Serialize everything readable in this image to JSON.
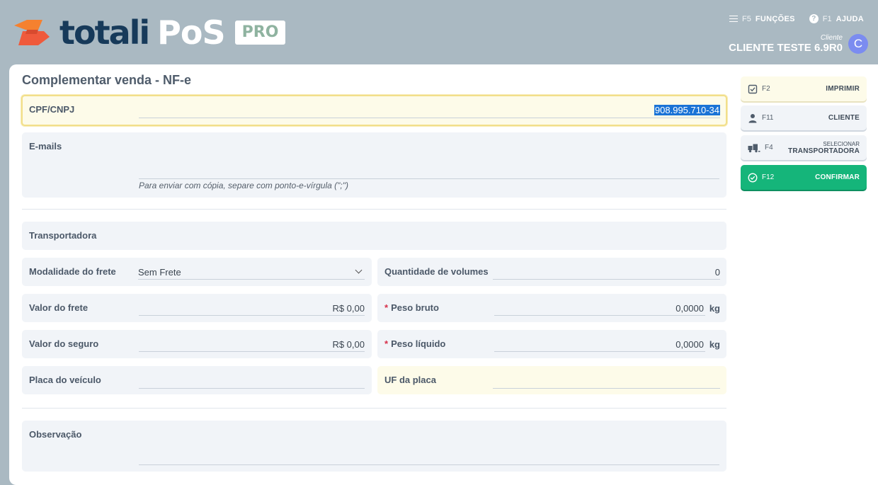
{
  "header": {
    "brand_part1": "totali",
    "brand_part2": "PoS",
    "brand_badge": "PRO",
    "functions_key": "F5",
    "functions_label": "FUNÇÕES",
    "help_key": "F1",
    "help_label": "AJUDA",
    "client_caption": "Cliente",
    "client_name": "CLIENTE TESTE 6.9R0",
    "avatar_letter": "C"
  },
  "page": {
    "title": "Complementar venda - NF-e"
  },
  "form": {
    "cpf": {
      "label": "CPF/CNPJ",
      "value": "908.995.710-34"
    },
    "emails": {
      "label": "E-mails",
      "value": "",
      "hint": "Para enviar com cópia, separe com ponto-e-vírgula (\";\")"
    },
    "carrier": {
      "label": "Transportadora",
      "value": ""
    },
    "freight_mode": {
      "label": "Modalidade do frete",
      "value": "Sem Frete"
    },
    "volumes": {
      "label": "Quantidade de volumes",
      "value": "0"
    },
    "freight_value": {
      "label": "Valor do frete",
      "value": "R$ 0,00"
    },
    "gross_weight": {
      "label": "Peso bruto",
      "required_mark": "*",
      "value": "0,0000",
      "unit": "kg"
    },
    "insurance_value": {
      "label": "Valor do seguro",
      "value": "R$ 0,00"
    },
    "net_weight": {
      "label": "Peso líquido",
      "required_mark": "*",
      "value": "0,0000",
      "unit": "kg"
    },
    "plate": {
      "label": "Placa do veículo",
      "value": ""
    },
    "plate_uf": {
      "label": "UF da placa",
      "value": ""
    },
    "notes": {
      "label": "Observação",
      "value": ""
    }
  },
  "actions": [
    {
      "key": "F2",
      "label": "IMPRIMIR",
      "icon": "checkbox-icon"
    },
    {
      "key": "F11",
      "label": "CLIENTE",
      "icon": "user-icon"
    },
    {
      "key": "F4",
      "label_small": "SELECIONAR",
      "label": "TRANSPORTADORA",
      "icon": "truck-icon"
    },
    {
      "key": "F12",
      "label": "CONFIRMAR",
      "icon": "check-circle-icon"
    }
  ],
  "colors": {
    "header_bg": "#aab9c2",
    "confirm_green": "#15b57a",
    "brand_navy": "#173a5a",
    "brand_orange": "#f26a3d"
  }
}
